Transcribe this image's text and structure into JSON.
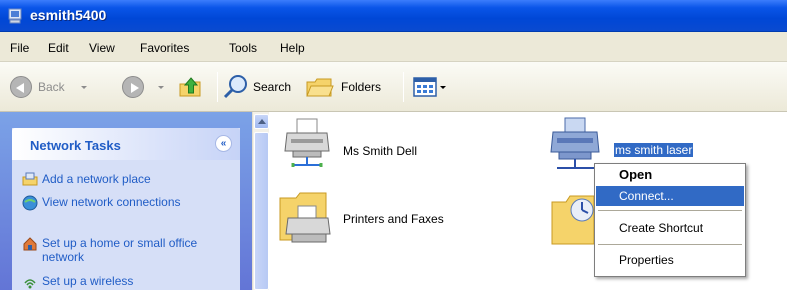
{
  "window": {
    "title": "esmith5400"
  },
  "menu": [
    "File",
    "Edit",
    "View",
    "Favorites",
    "Tools",
    "Help"
  ],
  "toolbar": {
    "back": "Back",
    "search": "Search",
    "folders": "Folders"
  },
  "tasks": {
    "header": "Network Tasks",
    "items": [
      "Add a network place",
      "View network connections",
      "Set up a home or small office network",
      "Set up a wireless"
    ]
  },
  "items": {
    "printer1": "Ms Smith Dell",
    "printer2": "ms smith laser",
    "printers_faxes": "Printers and Faxes"
  },
  "context_menu": {
    "open": "Open",
    "connect": "Connect...",
    "create_shortcut": "Create Shortcut",
    "properties": "Properties"
  },
  "colors": {
    "title_bar": "#0a55e8",
    "selection": "#316ac5",
    "task_text": "#215dc6"
  }
}
